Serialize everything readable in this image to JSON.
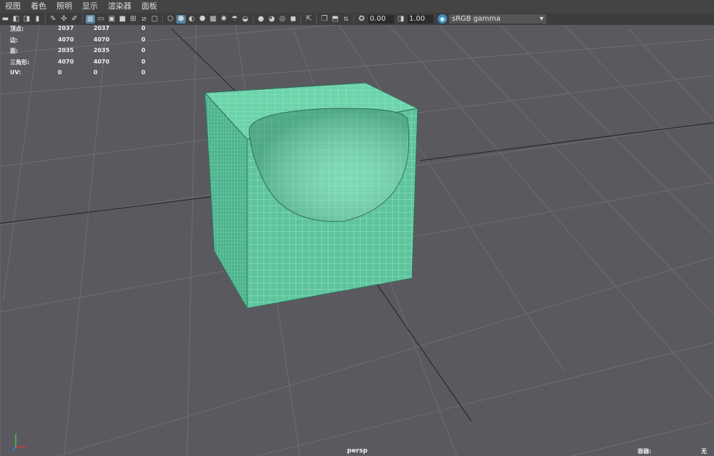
{
  "menubar": {
    "items": [
      "视图",
      "着色",
      "照明",
      "显示",
      "渲染器",
      "面板"
    ]
  },
  "toolbar": {
    "icons": [
      "camera-select-icon",
      "camera-attributes-icon",
      "bookmark-icon",
      "image-plane-icon",
      "grease-pencil-icon",
      "2d-pan-zoom-icon",
      "grid-toggle-icon",
      "film-gate-icon",
      "resolution-gate-icon",
      "gate-mask-icon",
      "field-chart-icon",
      "safe-action-icon",
      "wireframe-icon",
      "smooth-shade-icon",
      "wireframe-on-shaded-icon",
      "textured-icon",
      "use-all-lights-icon",
      "shadows-icon",
      "screen-space-ao-icon",
      "motion-blur-icon",
      "multisample-aa-icon",
      "depth-of-field-icon",
      "isolate-select-icon",
      "xray-icon",
      "xray-joints-icon",
      "backface-culling-icon"
    ],
    "exposure_value": "0.00",
    "gamma_value": "1.00",
    "colorspace": "sRGB gamma",
    "accent": "#5285a6"
  },
  "hud": {
    "rows": [
      {
        "label": "顶点:",
        "v1": "2037",
        "v2": "2037",
        "v3": "0"
      },
      {
        "label": "边:",
        "v1": "4070",
        "v2": "4070",
        "v3": "0"
      },
      {
        "label": "面:",
        "v1": "2035",
        "v2": "2035",
        "v3": "0"
      },
      {
        "label": "三角形:",
        "v1": "4070",
        "v2": "4070",
        "v3": "0"
      },
      {
        "label": "UV:",
        "v1": "0",
        "v2": "0",
        "v3": "0"
      }
    ]
  },
  "viewport": {
    "camera": "persp",
    "footer_label": "容器:",
    "footer_value": "无",
    "mesh_color": "#63c9a2",
    "wire_color": "#9af7d3",
    "grid_color": "#6c6a70",
    "background": "#5b5960"
  }
}
